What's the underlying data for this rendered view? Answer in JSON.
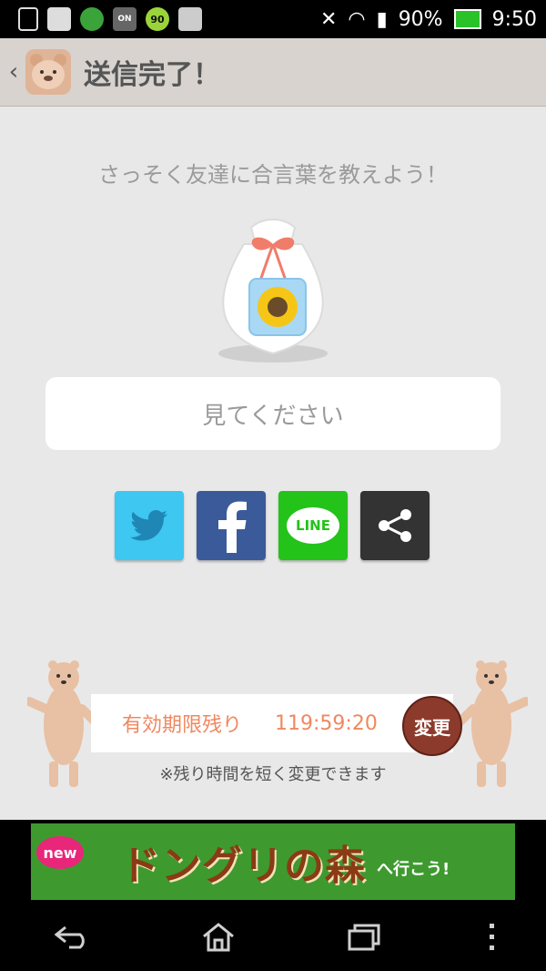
{
  "status_bar": {
    "battery": "90%",
    "time": "9:50",
    "icons": [
      "screenshot-icon",
      "gallery-icon",
      "security-app-icon",
      "phone-on-icon",
      "speed-90-icon",
      "clipboard-icon"
    ]
  },
  "action_bar": {
    "title": "送信完了！"
  },
  "main": {
    "prompt": "さっそく友達に合言葉を教えよう！",
    "keyword": "見てください",
    "share_buttons": [
      {
        "service": "Twitter",
        "icon": "twitter-bird-icon",
        "color": "#3ec7f0"
      },
      {
        "service": "Facebook",
        "icon": "facebook-f-icon",
        "color": "#3b5a9a"
      },
      {
        "service": "LINE",
        "label": "LINE",
        "icon": "line-bubble-icon",
        "color": "#23c31a"
      },
      {
        "service": "Share",
        "icon": "share-icon",
        "color": "#333333"
      }
    ],
    "timer": {
      "label": "有効期限残り",
      "value": "119:59:20",
      "change_button": "変更",
      "note": "※残り時間を短く変更できます"
    }
  },
  "ad": {
    "badge": "new",
    "title": "ドングリの森",
    "subtitle": "へ行こう!"
  },
  "nav_bar": {
    "items": [
      "back-icon",
      "home-icon",
      "recent-apps-icon",
      "menu-icon"
    ]
  }
}
